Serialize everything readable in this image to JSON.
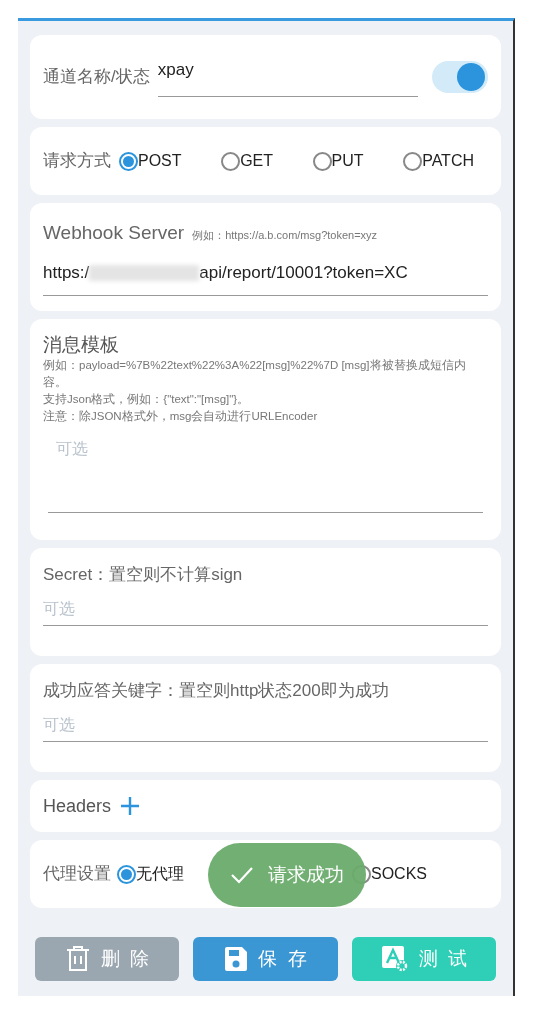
{
  "channel": {
    "label": "通道名称/状态",
    "value": "xpay",
    "on": true
  },
  "method": {
    "label": "请求方式",
    "options": [
      {
        "label": "POST",
        "selected": true
      },
      {
        "label": "GET",
        "selected": false
      },
      {
        "label": "PUT",
        "selected": false
      },
      {
        "label": "PATCH",
        "selected": false
      }
    ]
  },
  "webhook": {
    "label": "Webhook Server",
    "hint": "例如：https://a.b.com/msg?token=xyz",
    "value_start": "https:/",
    "value_end": "api/report/10001?token=XC"
  },
  "template": {
    "label": "消息模板",
    "notes": [
      "例如：payload=%7B%22text%22%3A%22[msg]%22%7D [msg]将被替换成短信内容。",
      "支持Json格式，例如：{\"text\":\"[msg]\"}。",
      "注意：除JSON格式外，msg会自动进行URLEncoder"
    ],
    "placeholder": "可选"
  },
  "secret": {
    "label": "Secret：置空则不计算sign",
    "placeholder": "可选"
  },
  "keyword": {
    "label": "成功应答关键字：置空则http状态200即为成功",
    "placeholder": "可选"
  },
  "headers": {
    "label": "Headers"
  },
  "proxy": {
    "label": "代理设置",
    "options": [
      {
        "label": "无代理",
        "selected": true
      },
      {
        "label": "SOCKS",
        "selected": false
      }
    ]
  },
  "buttons": [
    {
      "label": "删  除",
      "kind": "delete"
    },
    {
      "label": "保  存",
      "kind": "save"
    },
    {
      "label": "测  试",
      "kind": "test"
    }
  ],
  "toast": {
    "text": "请求成功"
  }
}
